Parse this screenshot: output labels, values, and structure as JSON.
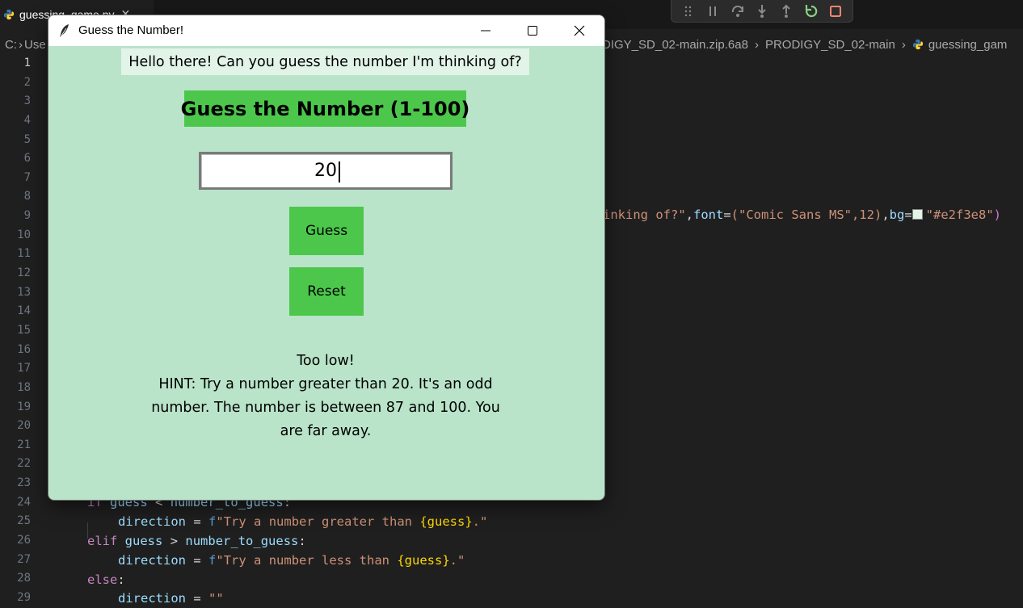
{
  "vscode": {
    "tab": {
      "filename": "guessing_game.py",
      "close": "✕"
    },
    "breadcrumb": {
      "left": [
        "C:",
        "Use"
      ],
      "right": [
        "DIGY_SD_02-main.zip.6a8",
        "PRODIGY_SD_02-main",
        "guessing_gam"
      ]
    },
    "line_numbers": [
      "1",
      "2",
      "3",
      "4",
      "5",
      "6",
      "7",
      "8",
      "9",
      "10",
      "11",
      "12",
      "13",
      "14",
      "15",
      "16",
      "17",
      "18",
      "19",
      "20",
      "21",
      "22",
      "23",
      "24",
      "25",
      "26",
      "27",
      "28",
      "29"
    ],
    "code": {
      "line9_a": "inking of?\"",
      "line9_font_kw": "font",
      "line9_font_val": "(\"Comic Sans MS\",12)",
      "line9_bg_kw": "bg",
      "line9_bg_val": "\"#e2f3e8\"",
      "line24_if": "if",
      "line24_guess": "guess",
      "line24_op": "<",
      "line24_target": "number_to_guess",
      "line25_var": "direction",
      "line25_str": "\"Try a number greater than ",
      "line25_brace": "{guess}",
      "line25_end": ".\"",
      "line26_elif": "elif",
      "line26_guess": "guess",
      "line26_op": ">",
      "line26_target": "number_to_guess",
      "line27_var": "direction",
      "line27_str": "\"Try a number less than ",
      "line27_brace": "{guess}",
      "line27_end": ".\"",
      "line28_else": "else",
      "line29_var": "direction",
      "line29_str": "\"\""
    },
    "colors": {
      "background": "#1f1f1f",
      "swatch": "#e2f3e8"
    }
  },
  "window": {
    "title": "Guess the Number!",
    "greeting": "Hello there! Can you guess the number I'm thinking of?",
    "heading": "Guess the Number (1-100)",
    "entry_value": "20",
    "guess_button": "Guess",
    "reset_button": "Reset",
    "result_line1": "Too low!",
    "hint_line1": "HINT: Try a number greater than 20. It's an odd",
    "hint_line2": "number. The number is between 87 and 100. You",
    "hint_line3": "are far away.",
    "colors": {
      "background": "#b9e4c9",
      "label_bg": "#e2f3e8",
      "button": "#4cc74c"
    }
  }
}
